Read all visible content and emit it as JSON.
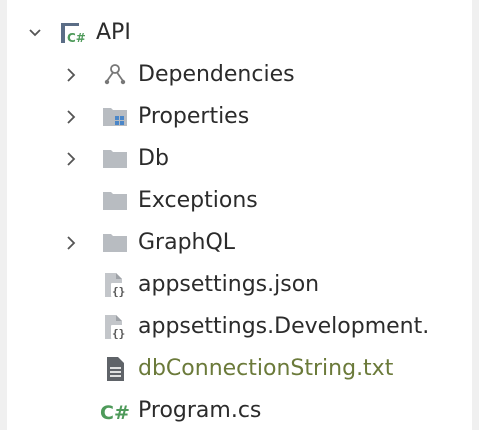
{
  "colors": {
    "text": "#2b2b2b",
    "modified_text": "#6b7a3a",
    "folder": "#b8bcc1",
    "csharp": "#4e9a5a"
  },
  "tree": {
    "root": {
      "label": "API",
      "icon": "csharp-project-icon",
      "expanded": true
    },
    "items": [
      {
        "label": "Dependencies",
        "icon": "dependencies-icon",
        "collapsed": true
      },
      {
        "label": "Properties",
        "icon": "properties-folder-icon",
        "collapsed": true
      },
      {
        "label": "Db",
        "icon": "folder-icon",
        "collapsed": true
      },
      {
        "label": "Exceptions",
        "icon": "folder-icon"
      },
      {
        "label": "GraphQL",
        "icon": "folder-icon",
        "collapsed": true
      },
      {
        "label": "appsettings.json",
        "icon": "json-file-icon"
      },
      {
        "label": "appsettings.Development.",
        "icon": "json-file-icon"
      },
      {
        "label": "dbConnectionString.txt",
        "icon": "text-file-icon",
        "modified": true
      },
      {
        "label": "Program.cs",
        "icon": "csharp-file-icon"
      }
    ]
  }
}
